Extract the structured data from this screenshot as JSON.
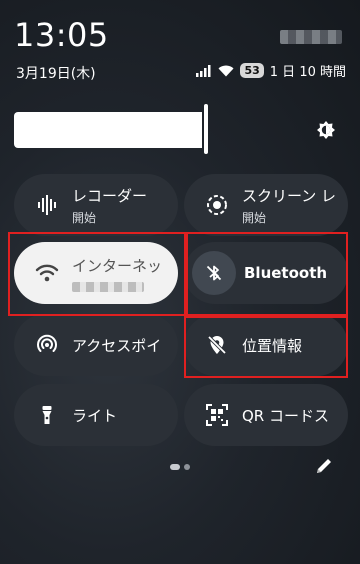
{
  "status": {
    "time": "13:05",
    "date": "3月19日(木)",
    "battery": "53",
    "remaining": "1 日 10 時間"
  },
  "brightness": {
    "level_percent": 53
  },
  "tiles": [
    {
      "label": "レコーダー",
      "sub": "開始",
      "icon": "waveform-icon"
    },
    {
      "label": "スクリーン レ",
      "sub": "開始",
      "icon": "screen-record-icon"
    },
    {
      "label": "インターネッ",
      "sub": "",
      "icon": "wifi-icon",
      "active": true
    },
    {
      "label": "Bluetooth",
      "sub": "",
      "icon": "bluetooth-off-icon"
    },
    {
      "label": "アクセスポイ",
      "sub": "",
      "icon": "hotspot-icon"
    },
    {
      "label": "位置情報",
      "sub": "",
      "icon": "location-off-icon"
    },
    {
      "label": "ライト",
      "sub": "",
      "icon": "flashlight-icon"
    },
    {
      "label": "QR コードス",
      "sub": "",
      "icon": "qr-scan-icon"
    }
  ],
  "colors": {
    "highlight_box": "#e02020",
    "tile_bg": "#2b3037",
    "active_tile_bg": "#f2f2f2"
  }
}
